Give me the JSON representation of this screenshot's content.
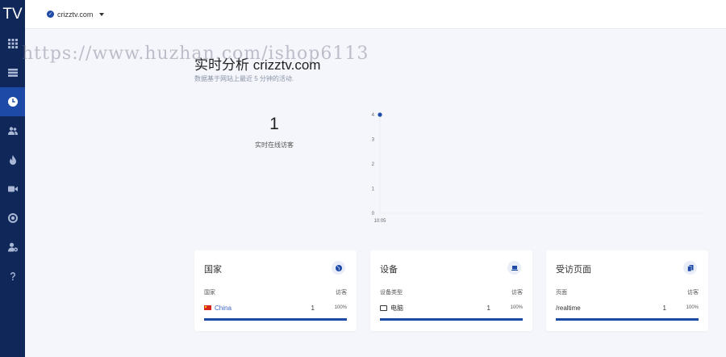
{
  "sidebar": {
    "logo": "TV",
    "items": [
      {
        "icon": "grid-icon",
        "active": false
      },
      {
        "icon": "list-icon",
        "active": false
      },
      {
        "icon": "clock-icon",
        "active": true
      },
      {
        "icon": "users-icon",
        "active": false
      },
      {
        "icon": "flame-icon",
        "active": false
      },
      {
        "icon": "video-icon",
        "active": false
      },
      {
        "icon": "target-icon",
        "active": false
      },
      {
        "icon": "user-settings-icon",
        "active": false
      },
      {
        "icon": "help-icon",
        "active": false
      }
    ]
  },
  "topbar": {
    "site": "crizztv.com"
  },
  "watermark": "https://www.huzhan.com/ishop6113",
  "header": {
    "title": "实时分析 crizztv.com",
    "subtitle": "数据基于网站上最近 5 分钟的活动."
  },
  "realtime": {
    "value": "1",
    "label": "实时在线访客"
  },
  "chart_data": {
    "type": "scatter",
    "x": [
      "10:05"
    ],
    "y": [
      4
    ],
    "yticks": [
      0,
      1,
      2,
      3,
      4
    ],
    "xticks": [
      "10:05"
    ],
    "ylim": [
      0,
      4
    ]
  },
  "cards": [
    {
      "title": "国家",
      "icon": "globe-icon",
      "col_left": "国家",
      "col_right": "访客",
      "row": {
        "label": "China",
        "count": "1",
        "pct": "100%",
        "fraction": 1.0
      }
    },
    {
      "title": "设备",
      "icon": "laptop-icon",
      "col_left": "设备类型",
      "col_right": "访客",
      "row": {
        "label": "电脑",
        "count": "1",
        "pct": "100%",
        "fraction": 1.0
      }
    },
    {
      "title": "受访页面",
      "icon": "pages-icon",
      "col_left": "页面",
      "col_right": "访客",
      "row": {
        "label": "/realtime",
        "count": "1",
        "pct": "100%",
        "fraction": 1.0
      }
    }
  ],
  "colors": {
    "sidebar": "#10275a",
    "accent": "#1d4aa6",
    "background": "#f4f6fb"
  }
}
